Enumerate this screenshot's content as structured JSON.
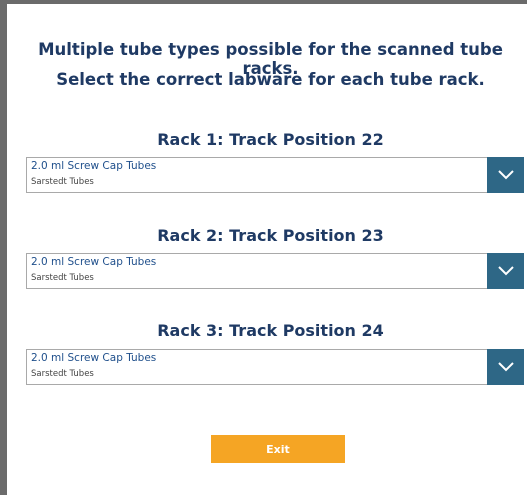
{
  "header": {
    "line1": "Multiple tube types possible for the scanned tube racks.",
    "line2": "Select the correct labware for each tube rack."
  },
  "racks": [
    {
      "title": "Rack 1: Track Position 22",
      "selected": "2.0 ml Screw Cap Tubes",
      "subtitle": "Sarstedt Tubes"
    },
    {
      "title": "Rack 2: Track Position 23",
      "selected": "2.0 ml Screw Cap Tubes",
      "subtitle": "Sarstedt Tubes"
    },
    {
      "title": "Rack 3: Track Position 24",
      "selected": "2.0 ml Screw Cap Tubes",
      "subtitle": "Sarstedt Tubes"
    }
  ],
  "buttons": {
    "exit": "Exit"
  },
  "icons": {
    "dropdown": "chevron-down-icon"
  },
  "colors": {
    "heading": "#1f3a64",
    "dropdown_button": "#2e6786",
    "exit_button": "#f5a524",
    "frame_border": "#6b6b6b"
  }
}
